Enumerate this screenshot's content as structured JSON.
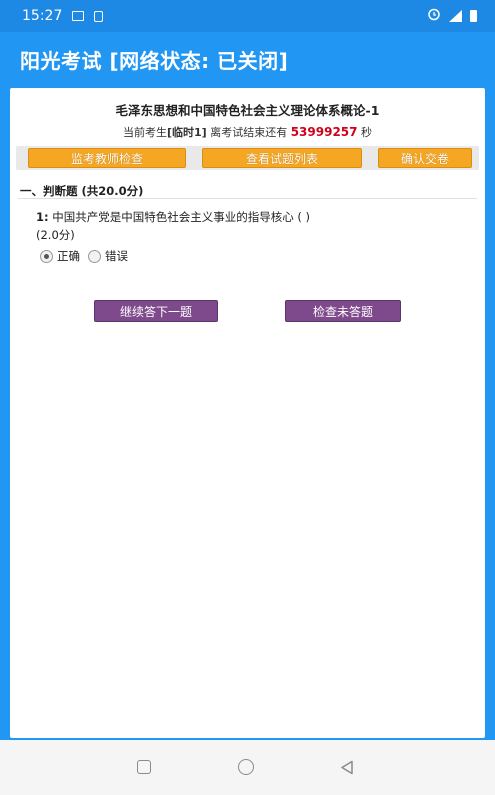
{
  "status_bar": {
    "time": "15:27"
  },
  "app_bar": {
    "title": "阳光考试 [网络状态:  已关闭]"
  },
  "exam": {
    "title": "毛泽东思想和中国特色社会主义理论体系概论-1",
    "timer_prefix": "当前考生",
    "student": "[临时1]",
    "timer_middle": "离考试结束还有",
    "seconds_left": "53999257",
    "timer_unit": "秒"
  },
  "toolbar": {
    "proctor_label": "监考教师检查",
    "list_label": "查看试题列表",
    "submit_label": "确认交卷"
  },
  "section": {
    "title": "一、判断题 (共20.0分)"
  },
  "question": {
    "number": "1:",
    "text": "中国共产党是中国特色社会主义事业的指导核心 ( )",
    "score": "(2.0分)",
    "options": [
      {
        "label": "正确",
        "checked": true
      },
      {
        "label": "错误",
        "checked": false
      }
    ]
  },
  "actions": {
    "next_label": "继续答下一题",
    "check_label": "检查未答题"
  },
  "icons": {
    "status_left": [
      "image-icon",
      "sim-icon"
    ],
    "status_right": [
      "alarm-icon",
      "signal-icon",
      "battery-icon"
    ],
    "nav": [
      "recents-icon",
      "home-icon",
      "back-icon"
    ]
  },
  "colors": {
    "primary": "#2196F3",
    "status_bar": "#1E88E5",
    "toolbar_button": "#F5A623",
    "action_button": "#7E4A8B",
    "timer_red": "#d0021b"
  }
}
